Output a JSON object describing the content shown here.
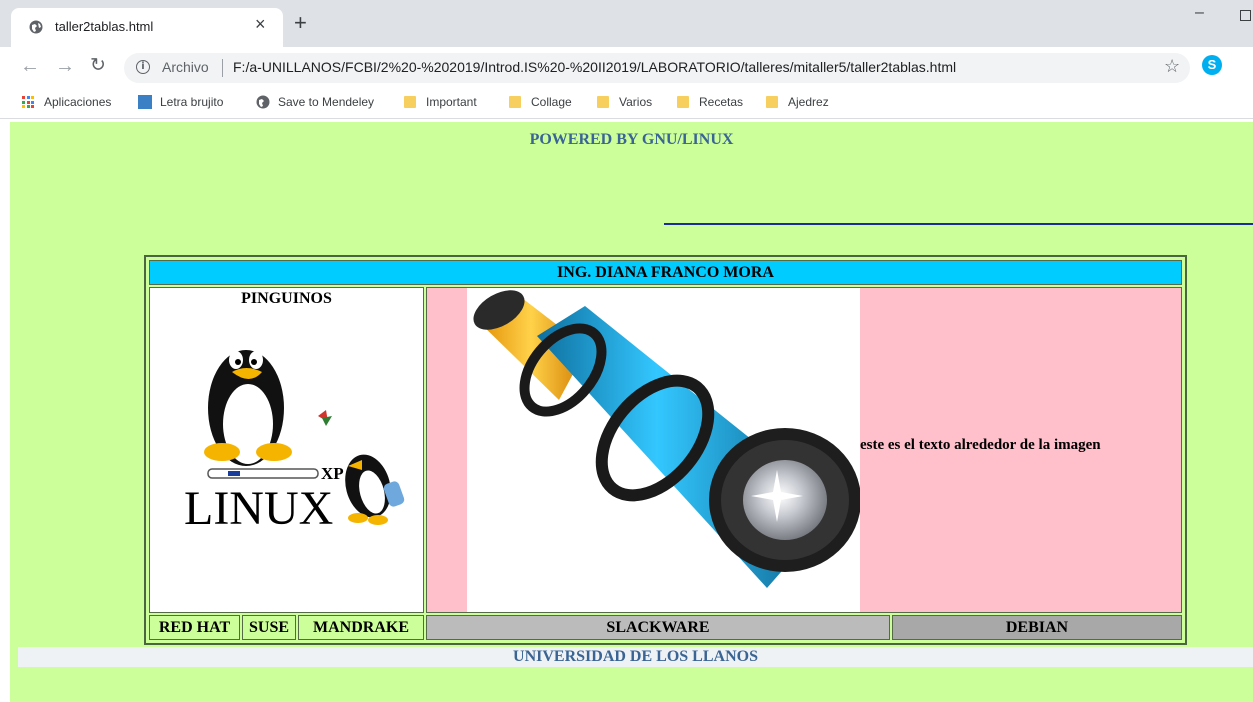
{
  "browser": {
    "tab_title": "taller2tablas.html",
    "tab_close": "×",
    "new_tab": "+",
    "minimize": "–",
    "address_scheme": "Archivo",
    "address_url": "F:/a-UNILLANOS/FCBI/2%20-%202019/Introd.IS%20-%20II2019/LABORATORIO/talleres/mitaller5/taller2tablas.html",
    "bookmarks": [
      "Aplicaciones",
      "Letra brujito",
      "Save to Mendeley",
      "Important",
      "Collage",
      "Varios",
      "Recetas",
      "Ajedrez"
    ]
  },
  "page": {
    "powered_by": "POWERED BY GNU/LINUX",
    "table_header": "ING. DIANA FRANCO MORA",
    "pinguinos_title": "PINGUINOS",
    "linux_logo_text": "LINUX",
    "linux_logo_xp": "XP",
    "image_side_text": "este es el texto alrededor de la imagen",
    "distros": {
      "redhat": "RED HAT",
      "suse": "SUSE",
      "mandrake": "MANDRAKE",
      "slackware": "SLACKWARE",
      "debian": "DEBIAN"
    },
    "footer": "UNIVERSIDAD DE LOS LLANOS"
  },
  "colors": {
    "page_background": "#ccff99",
    "header_cell": "#00ccff",
    "image_cell": "#ffc0cb",
    "link_text": "#3a6494",
    "hr_line": "#1a2e9b"
  }
}
